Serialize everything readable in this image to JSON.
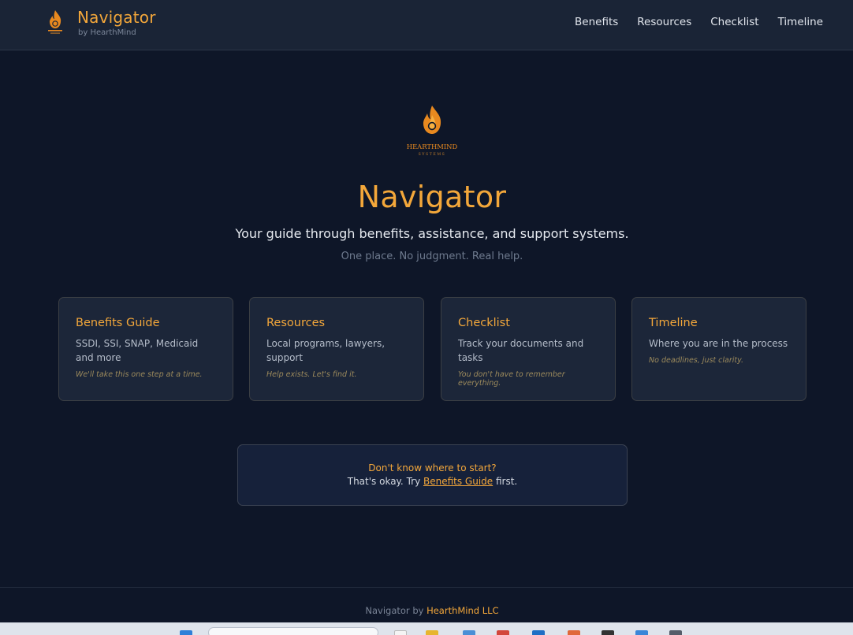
{
  "header": {
    "brand_title": "Navigator",
    "brand_sub": "by HearthMind",
    "nav": [
      "Benefits",
      "Resources",
      "Checklist",
      "Timeline"
    ]
  },
  "hero": {
    "logo_line1": "HEARTHMIND",
    "logo_line2": "SYSTEMS",
    "title": "Navigator",
    "tagline": "Your guide through benefits, assistance, and support systems.",
    "subtitle": "One place. No judgment. Real help."
  },
  "cards": [
    {
      "title": "Benefits Guide",
      "desc": "SSDI, SSI, SNAP, Medicaid and more",
      "note": "We'll take this one step at a time."
    },
    {
      "title": "Resources",
      "desc": "Local programs, lawyers, support",
      "note": "Help exists. Let's find it."
    },
    {
      "title": "Checklist",
      "desc": "Track your documents and tasks",
      "note": "You don't have to remember everything."
    },
    {
      "title": "Timeline",
      "desc": "Where you are in the process",
      "note": "No deadlines, just clarity."
    }
  ],
  "start_box": {
    "question": "Don't know where to start?",
    "line_prefix": "That's okay. Try ",
    "link": "Benefits Guide",
    "line_suffix": " first."
  },
  "footer": {
    "prefix": "Navigator by ",
    "company": "HearthMind LLC"
  },
  "colors": {
    "accent": "#f3a73a",
    "background": "#0e1628",
    "card": "#1c2639",
    "header": "#1a2436"
  },
  "icons": [
    "flame-logo-icon"
  ]
}
